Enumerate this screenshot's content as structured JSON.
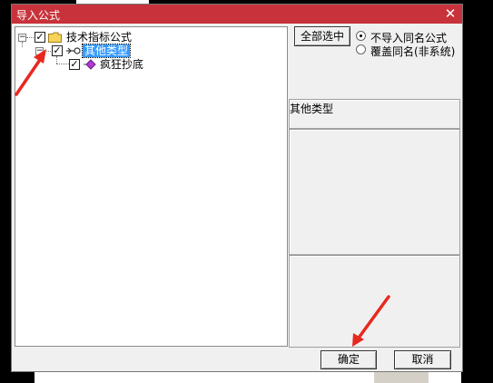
{
  "dialog": {
    "title": "导入公式",
    "close_glyph": "✕"
  },
  "tree": {
    "root": {
      "label": "技术指标公式",
      "checked": true,
      "expander": "−"
    },
    "category": {
      "label": "其他类型",
      "checked": true,
      "expander": "−",
      "selected": true
    },
    "formula": {
      "label": "疯狂抄底",
      "checked": true
    }
  },
  "options": {
    "select_all_label": "全部选中",
    "radios": [
      {
        "label": "不导入同名公式",
        "selected": true
      },
      {
        "label": "覆盖同名(非系统)",
        "selected": false
      }
    ],
    "category_label": "其他类型"
  },
  "footer": {
    "ok_label": "确定",
    "cancel_label": "取消"
  },
  "colors": {
    "title_bar": "#c8323a",
    "selection": "#3399ff",
    "annotation_arrow": "#e8281e"
  }
}
